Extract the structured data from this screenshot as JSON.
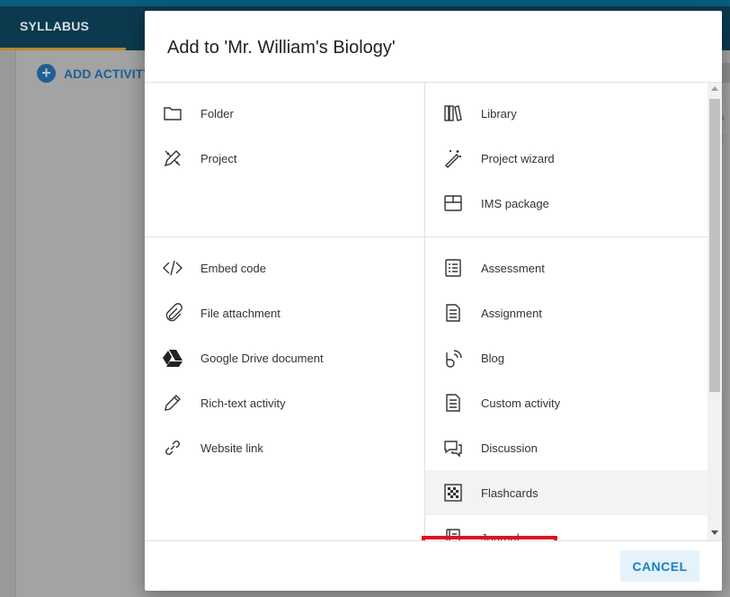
{
  "background": {
    "tab_label": "SYLLABUS",
    "add_activity_label": "ADD ACTIVITY",
    "right_edge_chars": [
      "a",
      "c"
    ]
  },
  "dialog": {
    "title": "Add to 'Mr. William's Biology'",
    "cancel_label": "CANCEL",
    "items": {
      "folder": "Folder",
      "project": "Project",
      "library": "Library",
      "project_wizard": "Project wizard",
      "ims_package": "IMS package",
      "embed_code": "Embed code",
      "file_attachment": "File attachment",
      "google_drive": "Google Drive document",
      "rich_text": "Rich-text activity",
      "website_link": "Website link",
      "assessment": "Assessment",
      "assignment": "Assignment",
      "blog": "Blog",
      "custom_activity": "Custom activity",
      "discussion": "Discussion",
      "flashcards": "Flashcards",
      "journal": "Journal"
    },
    "highlighted_item": "Flashcards",
    "highlight_color": "#e0101c",
    "accent_color": "#1a7fc1"
  }
}
